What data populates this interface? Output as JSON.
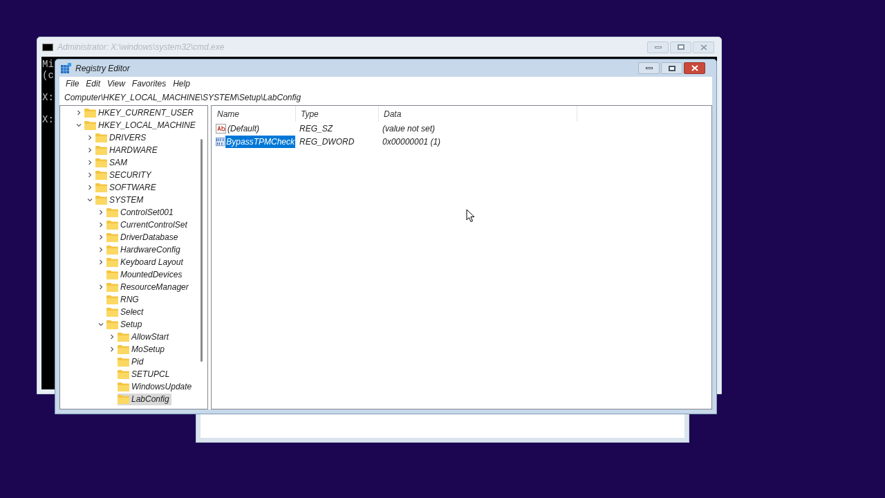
{
  "console_window": {
    "title": "Administrator: X:\\windows\\system32\\cmd.exe",
    "paragraphs": [
      [
        "Mi",
        "(c"
      ],
      [
        "X:"
      ],
      [
        "X:"
      ]
    ]
  },
  "registry_editor": {
    "title": "Registry Editor",
    "menu": [
      "File",
      "Edit",
      "View",
      "Favorites",
      "Help"
    ],
    "address": "Computer\\HKEY_LOCAL_MACHINE\\SYSTEM\\Setup\\LabConfig",
    "tree": [
      {
        "label": "HKEY_CURRENT_USER",
        "expanded": false,
        "selected": false
      },
      {
        "label": "HKEY_LOCAL_MACHINE",
        "expanded": true,
        "selected": false,
        "children": [
          {
            "label": "DRIVERS",
            "expanded": false,
            "selected": false
          },
          {
            "label": "HARDWARE",
            "expanded": false,
            "selected": false
          },
          {
            "label": "SAM",
            "expanded": false,
            "selected": false
          },
          {
            "label": "SECURITY",
            "expanded": false,
            "selected": false
          },
          {
            "label": "SOFTWARE",
            "expanded": false,
            "selected": false
          },
          {
            "label": "SYSTEM",
            "expanded": true,
            "selected": false,
            "children": [
              {
                "label": "ControlSet001",
                "expanded": false,
                "selected": false
              },
              {
                "label": "CurrentControlSet",
                "expanded": false,
                "selected": false
              },
              {
                "label": "DriverDatabase",
                "expanded": false,
                "selected": false
              },
              {
                "label": "HardwareConfig",
                "expanded": false,
                "selected": false
              },
              {
                "label": "Keyboard Layout",
                "expanded": false,
                "selected": false
              },
              {
                "label": "MountedDevices",
                "selected": false
              },
              {
                "label": "ResourceManager",
                "expanded": false,
                "selected": false
              },
              {
                "label": "RNG",
                "selected": false
              },
              {
                "label": "Select",
                "selected": false
              },
              {
                "label": "Setup",
                "expanded": true,
                "selected": false,
                "children": [
                  {
                    "label": "AllowStart",
                    "expanded": false,
                    "selected": false
                  },
                  {
                    "label": "MoSetup",
                    "expanded": false,
                    "selected": false
                  },
                  {
                    "label": "Pid",
                    "selected": false
                  },
                  {
                    "label": "SETUPCL",
                    "selected": false
                  },
                  {
                    "label": "WindowsUpdate",
                    "selected": false
                  },
                  {
                    "label": "LabConfig",
                    "selected": true
                  }
                ]
              }
            ]
          }
        ]
      }
    ],
    "columns": [
      "Name",
      "Type",
      "Data"
    ],
    "values": [
      {
        "name": "(Default)",
        "type": "REG_SZ",
        "data": "(value not set)",
        "kind": "string",
        "selected": false
      },
      {
        "name": "BypassTPMCheck",
        "type": "REG_DWORD",
        "data": "0x00000001 (1)",
        "kind": "binary",
        "selected": true
      }
    ]
  }
}
